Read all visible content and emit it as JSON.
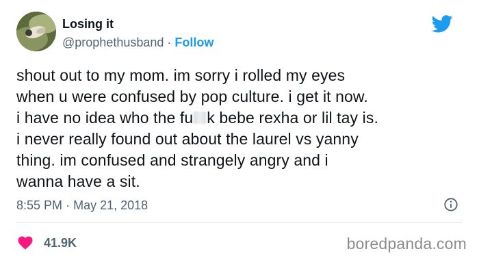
{
  "author": {
    "display_name": "Losing it",
    "handle": "@prophethusband",
    "separator": "·",
    "follow_label": "Follow"
  },
  "tweet": {
    "lines": [
      "shout out to my mom. im sorry i rolled my eyes",
      "when u were confused by pop culture. i get it now.",
      "i have no idea who the fu",
      "k bebe rexha or lil tay is.",
      "i never really found out about the laurel vs yanny",
      "thing. im confused and strangely angry and i",
      "wanna have a sit."
    ]
  },
  "meta": {
    "time": "8:55 PM",
    "separator": "·",
    "date": "May 21, 2018"
  },
  "engagement": {
    "likes": "41.9K"
  },
  "watermark": "boredpanda.com",
  "colors": {
    "accent": "#1d9bf0",
    "like": "#f91880",
    "text": "#0f1419",
    "secondary": "#536471"
  },
  "icons": {
    "brand": "twitter-bird-icon",
    "info": "info-icon",
    "like": "heart-icon"
  }
}
